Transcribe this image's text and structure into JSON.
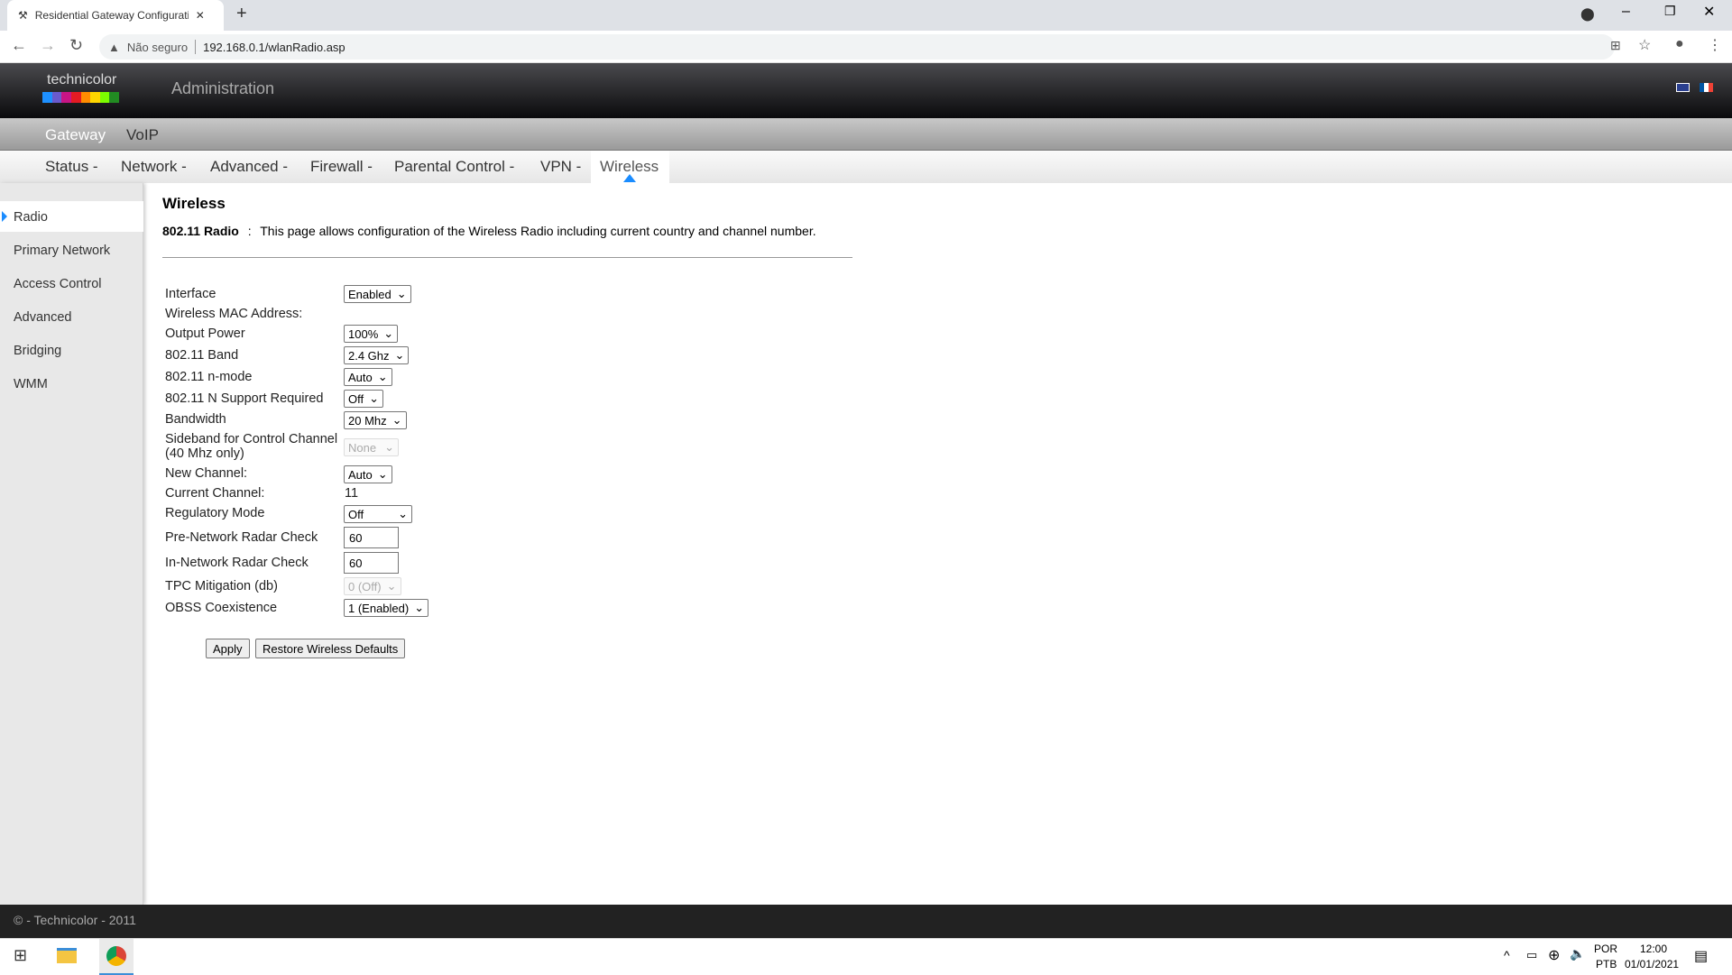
{
  "browser": {
    "tab_title": "Residential Gateway Configuration",
    "security": "Não seguro",
    "url": "192.168.0.1/wlanRadio.asp"
  },
  "header": {
    "logo": "technicolor",
    "title": "Administration",
    "logo_colors": [
      "#1e90ff",
      "#6a5acd",
      "#c71585",
      "#e31b23",
      "#ff8c00",
      "#ffd700",
      "#7cfc00",
      "#228b22"
    ]
  },
  "topmenu": [
    "Gateway",
    "VoIP"
  ],
  "submenu": [
    "Status -",
    "Network -",
    "Advanced -",
    "Firewall -",
    "Parental Control -",
    "VPN -",
    "Wireless"
  ],
  "sidebar": [
    "Radio",
    "Primary Network",
    "Access Control",
    "Advanced",
    "Bridging",
    "WMM"
  ],
  "page": {
    "title": "Wireless",
    "subtitle": "802.11 Radio",
    "separator": ":",
    "description": "This page allows configuration of the Wireless Radio including current country and channel number."
  },
  "form": {
    "interface": {
      "label": "Interface",
      "value": "Enabled"
    },
    "mac": {
      "label": "Wireless MAC Address:"
    },
    "output_power": {
      "label": "Output Power",
      "value": "100%"
    },
    "band": {
      "label": "802.11 Band",
      "value": "2.4 Ghz"
    },
    "nmode": {
      "label": "802.11 n-mode",
      "value": "Auto"
    },
    "nsupport": {
      "label": "802.11 N Support Required",
      "value": "Off"
    },
    "bandwidth": {
      "label": "Bandwidth",
      "value": "20 Mhz"
    },
    "sideband": {
      "label1": "Sideband for Control Channel",
      "label2": "(40 Mhz only)",
      "value": "None"
    },
    "new_channel": {
      "label": "New Channel:",
      "value": "Auto"
    },
    "current_channel": {
      "label": "Current Channel:",
      "value": "11"
    },
    "regulatory": {
      "label": "Regulatory Mode",
      "value": "Off"
    },
    "pre_radar": {
      "label": "Pre-Network Radar Check",
      "value": "60"
    },
    "in_radar": {
      "label": "In-Network Radar Check",
      "value": "60"
    },
    "tpc": {
      "label": "TPC Mitigation (db)",
      "value": "0 (Off)"
    },
    "obss": {
      "label": "OBSS Coexistence",
      "value": "1 (Enabled)"
    }
  },
  "buttons": {
    "apply": "Apply",
    "restore": "Restore Wireless Defaults"
  },
  "footer": "© - Technicolor - 2011",
  "taskbar": {
    "lang1": "POR",
    "lang2": "PTB",
    "time": "12:00",
    "date": "01/01/2021"
  }
}
